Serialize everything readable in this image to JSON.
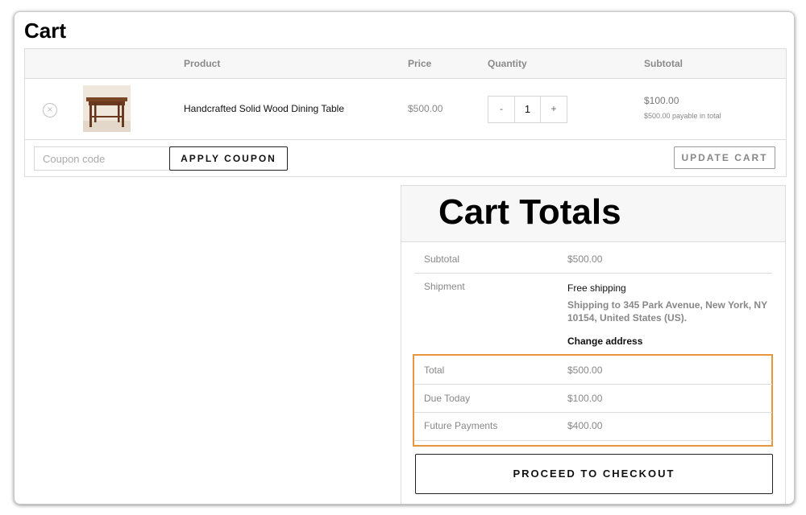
{
  "page": {
    "title": "Cart"
  },
  "cart_table": {
    "headers": {
      "product": "Product",
      "price": "Price",
      "quantity": "Quantity",
      "subtotal": "Subtotal"
    },
    "items": [
      {
        "remove_icon": "remove-circle-x-icon",
        "thumbnail": "wooden-dining-table-image",
        "name": "Handcrafted Solid Wood Dining Table",
        "price": "$500.00",
        "quantity": "1",
        "qty_minus": "-",
        "qty_plus": "+",
        "subtotal": "$100.00",
        "subtotal_note": "$500.00 payable in total"
      }
    ],
    "actions": {
      "coupon_placeholder": "Coupon code",
      "coupon_value": "",
      "apply_label": "APPLY COUPON",
      "update_label": "UPDATE CART"
    }
  },
  "totals": {
    "title": "Cart Totals",
    "subtotal_label": "Subtotal",
    "subtotal_value": "$500.00",
    "shipment_label": "Shipment",
    "shipping_method": "Free shipping",
    "shipping_address": "Shipping to 345 Park Avenue, New York, NY 10154, United States (US).",
    "change_address_label": "Change address",
    "total_label": "Total",
    "total_value": "$500.00",
    "due_today_label": "Due Today",
    "due_today_value": "$100.00",
    "future_payments_label": "Future Payments",
    "future_payments_value": "$400.00",
    "checkout_label": "PROCEED TO CHECKOUT"
  },
  "colors": {
    "highlight": "#e8963c",
    "header_bg": "#f7f7f7",
    "border": "#dcdcdc"
  }
}
